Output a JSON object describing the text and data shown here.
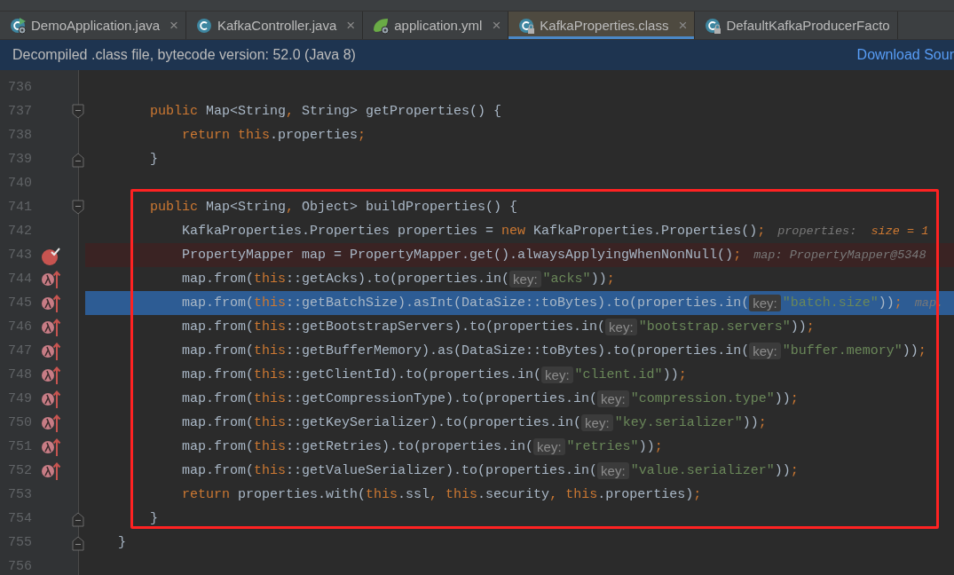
{
  "tabs": [
    {
      "label": "DemoApplication.java",
      "selected": false,
      "close": "×"
    },
    {
      "label": "KafkaController.java",
      "selected": false,
      "close": "×"
    },
    {
      "label": "application.yml",
      "selected": false,
      "close": "×"
    },
    {
      "label": "KafkaProperties.class",
      "selected": true,
      "close": "×"
    },
    {
      "label": "DefaultKafkaProducerFacto",
      "selected": false
    }
  ],
  "banner": {
    "message": "Decompiled .class file, bytecode version: 52.0 (Java 8)",
    "link": "Download Sour"
  },
  "editor": {
    "lines": [
      {
        "number": "736",
        "breakpoint": false,
        "lambda": false,
        "fold_start": false,
        "fold_end": false,
        "selected": false
      },
      {
        "number": "737",
        "breakpoint": false,
        "lambda": false,
        "fold_start": true,
        "fold_end": false,
        "selected": false,
        "segments": [
          {
            "kind": "code",
            "tokens": [
              {
                "text": "    public ",
                "kind": "keyword"
              },
              {
                "text": "Map<String",
                "kind": "plain"
              },
              {
                "text": ", ",
                "kind": "keyword"
              },
              {
                "text": "String> getProperties() {",
                "kind": "plain"
              }
            ]
          }
        ]
      },
      {
        "number": "738",
        "breakpoint": false,
        "lambda": false,
        "fold_start": false,
        "fold_end": false,
        "selected": false,
        "segments": [
          {
            "kind": "code",
            "tokens": [
              {
                "text": "        return this",
                "kind": "keyword"
              },
              {
                "text": ".properties",
                "kind": "plain"
              },
              {
                "text": ";",
                "kind": "keyword"
              }
            ]
          }
        ]
      },
      {
        "number": "739",
        "breakpoint": false,
        "lambda": false,
        "fold_start": false,
        "fold_end": true,
        "selected": false,
        "segments": [
          {
            "kind": "code",
            "tokens": [
              {
                "text": "    }",
                "kind": "plain"
              }
            ]
          }
        ]
      },
      {
        "number": "740",
        "breakpoint": false,
        "lambda": false,
        "fold_start": false,
        "fold_end": false,
        "selected": false
      },
      {
        "number": "741",
        "breakpoint": false,
        "lambda": false,
        "fold_start": true,
        "fold_end": false,
        "selected": false,
        "segments": [
          {
            "kind": "code",
            "tokens": [
              {
                "text": "    public ",
                "kind": "keyword"
              },
              {
                "text": "Map<String",
                "kind": "plain"
              },
              {
                "text": ", ",
                "kind": "keyword"
              },
              {
                "text": "Object> buildProperties() {",
                "kind": "plain"
              }
            ]
          }
        ]
      },
      {
        "number": "742",
        "breakpoint": false,
        "lambda": false,
        "fold_start": false,
        "fold_end": false,
        "selected": false,
        "segments": [
          {
            "kind": "code",
            "tokens": [
              {
                "text": "        KafkaProperties.Properties properties = ",
                "kind": "plain"
              },
              {
                "text": "new ",
                "kind": "keyword"
              },
              {
                "text": "KafkaProperties.Properties()",
                "kind": "plain"
              },
              {
                "text": ";",
                "kind": "keyword"
              }
            ]
          },
          {
            "kind": "debug",
            "parts": [
              {
                "text": "properties:",
                "kind": "name"
              },
              {
                "text": "size = 1",
                "kind": "value"
              }
            ]
          }
        ]
      },
      {
        "number": "743",
        "breakpoint": true,
        "lambda": false,
        "fold_start": false,
        "fold_end": false,
        "selected": false,
        "segments": [
          {
            "kind": "code",
            "tokens": [
              {
                "text": "        PropertyMapper map = PropertyMapper.get().alwaysApplyingWhenNonNull()",
                "kind": "plain"
              },
              {
                "text": ";",
                "kind": "keyword"
              }
            ]
          },
          {
            "kind": "debug",
            "parts": [
              {
                "text": "map: PropertyMapper@5348",
                "kind": "name"
              }
            ]
          }
        ]
      },
      {
        "number": "744",
        "breakpoint": false,
        "lambda": true,
        "fold_start": false,
        "fold_end": false,
        "selected": false,
        "segments": [
          {
            "kind": "code",
            "tokens": [
              {
                "text": "        map.from(",
                "kind": "plain"
              },
              {
                "text": "this",
                "kind": "keyword"
              },
              {
                "text": "::getAcks).to(properties.in(",
                "kind": "plain"
              }
            ]
          },
          {
            "kind": "hint",
            "text": "key:"
          },
          {
            "kind": "code",
            "tokens": [
              {
                "text": "\"acks\"",
                "kind": "string"
              },
              {
                "text": "))",
                "kind": "plain"
              },
              {
                "text": ";",
                "kind": "keyword"
              }
            ]
          }
        ]
      },
      {
        "number": "745",
        "breakpoint": false,
        "lambda": true,
        "fold_start": false,
        "fold_end": false,
        "selected": true,
        "segments": [
          {
            "kind": "code",
            "tokens": [
              {
                "text": "        map.from(",
                "kind": "plain"
              },
              {
                "text": "this",
                "kind": "keyword"
              },
              {
                "text": "::getBatchSize).asInt(DataSize::toBytes).to(properties.in(",
                "kind": "plain"
              }
            ]
          },
          {
            "kind": "hint",
            "text": "key:"
          },
          {
            "kind": "code",
            "tokens": [
              {
                "text": "\"batch.size\"",
                "kind": "string"
              },
              {
                "text": "))",
                "kind": "plain"
              },
              {
                "text": ";",
                "kind": "keyword"
              }
            ]
          },
          {
            "kind": "debug",
            "parts": [
              {
                "text": "map.",
                "kind": "name"
              }
            ]
          }
        ]
      },
      {
        "number": "746",
        "breakpoint": false,
        "lambda": true,
        "fold_start": false,
        "fold_end": false,
        "selected": false,
        "segments": [
          {
            "kind": "code",
            "tokens": [
              {
                "text": "        map.from(",
                "kind": "plain"
              },
              {
                "text": "this",
                "kind": "keyword"
              },
              {
                "text": "::getBootstrapServers).to(properties.in(",
                "kind": "plain"
              }
            ]
          },
          {
            "kind": "hint",
            "text": "key:"
          },
          {
            "kind": "code",
            "tokens": [
              {
                "text": "\"bootstrap.servers\"",
                "kind": "string"
              },
              {
                "text": "))",
                "kind": "plain"
              },
              {
                "text": ";",
                "kind": "keyword"
              }
            ]
          }
        ]
      },
      {
        "number": "747",
        "breakpoint": false,
        "lambda": true,
        "fold_start": false,
        "fold_end": false,
        "selected": false,
        "segments": [
          {
            "kind": "code",
            "tokens": [
              {
                "text": "        map.from(",
                "kind": "plain"
              },
              {
                "text": "this",
                "kind": "keyword"
              },
              {
                "text": "::getBufferMemory).as(DataSize::toBytes).to(properties.in(",
                "kind": "plain"
              }
            ]
          },
          {
            "kind": "hint",
            "text": "key:"
          },
          {
            "kind": "code",
            "tokens": [
              {
                "text": "\"buffer.memory\"",
                "kind": "string"
              },
              {
                "text": "))",
                "kind": "plain"
              },
              {
                "text": ";",
                "kind": "keyword"
              }
            ]
          }
        ]
      },
      {
        "number": "748",
        "breakpoint": false,
        "lambda": true,
        "fold_start": false,
        "fold_end": false,
        "selected": false,
        "segments": [
          {
            "kind": "code",
            "tokens": [
              {
                "text": "        map.from(",
                "kind": "plain"
              },
              {
                "text": "this",
                "kind": "keyword"
              },
              {
                "text": "::getClientId).to(properties.in(",
                "kind": "plain"
              }
            ]
          },
          {
            "kind": "hint",
            "text": "key:"
          },
          {
            "kind": "code",
            "tokens": [
              {
                "text": "\"client.id\"",
                "kind": "string"
              },
              {
                "text": "))",
                "kind": "plain"
              },
              {
                "text": ";",
                "kind": "keyword"
              }
            ]
          }
        ]
      },
      {
        "number": "749",
        "breakpoint": false,
        "lambda": true,
        "fold_start": false,
        "fold_end": false,
        "selected": false,
        "segments": [
          {
            "kind": "code",
            "tokens": [
              {
                "text": "        map.from(",
                "kind": "plain"
              },
              {
                "text": "this",
                "kind": "keyword"
              },
              {
                "text": "::getCompressionType).to(properties.in(",
                "kind": "plain"
              }
            ]
          },
          {
            "kind": "hint",
            "text": "key:"
          },
          {
            "kind": "code",
            "tokens": [
              {
                "text": "\"compression.type\"",
                "kind": "string"
              },
              {
                "text": "))",
                "kind": "plain"
              },
              {
                "text": ";",
                "kind": "keyword"
              }
            ]
          }
        ]
      },
      {
        "number": "750",
        "breakpoint": false,
        "lambda": true,
        "fold_start": false,
        "fold_end": false,
        "selected": false,
        "segments": [
          {
            "kind": "code",
            "tokens": [
              {
                "text": "        map.from(",
                "kind": "plain"
              },
              {
                "text": "this",
                "kind": "keyword"
              },
              {
                "text": "::getKeySerializer).to(properties.in(",
                "kind": "plain"
              }
            ]
          },
          {
            "kind": "hint",
            "text": "key:"
          },
          {
            "kind": "code",
            "tokens": [
              {
                "text": "\"key.serializer\"",
                "kind": "string"
              },
              {
                "text": "))",
                "kind": "plain"
              },
              {
                "text": ";",
                "kind": "keyword"
              }
            ]
          }
        ]
      },
      {
        "number": "751",
        "breakpoint": false,
        "lambda": true,
        "fold_start": false,
        "fold_end": false,
        "selected": false,
        "segments": [
          {
            "kind": "code",
            "tokens": [
              {
                "text": "        map.from(",
                "kind": "plain"
              },
              {
                "text": "this",
                "kind": "keyword"
              },
              {
                "text": "::getRetries).to(properties.in(",
                "kind": "plain"
              }
            ]
          },
          {
            "kind": "hint",
            "text": "key:"
          },
          {
            "kind": "code",
            "tokens": [
              {
                "text": "\"retries\"",
                "kind": "string"
              },
              {
                "text": "))",
                "kind": "plain"
              },
              {
                "text": ";",
                "kind": "keyword"
              }
            ]
          }
        ]
      },
      {
        "number": "752",
        "breakpoint": false,
        "lambda": true,
        "fold_start": false,
        "fold_end": false,
        "selected": false,
        "segments": [
          {
            "kind": "code",
            "tokens": [
              {
                "text": "        map.from(",
                "kind": "plain"
              },
              {
                "text": "this",
                "kind": "keyword"
              },
              {
                "text": "::getValueSerializer).to(properties.in(",
                "kind": "plain"
              }
            ]
          },
          {
            "kind": "hint",
            "text": "key:"
          },
          {
            "kind": "code",
            "tokens": [
              {
                "text": "\"value.serializer\"",
                "kind": "string"
              },
              {
                "text": "))",
                "kind": "plain"
              },
              {
                "text": ";",
                "kind": "keyword"
              }
            ]
          }
        ]
      },
      {
        "number": "753",
        "breakpoint": false,
        "lambda": false,
        "fold_start": false,
        "fold_end": false,
        "selected": false,
        "segments": [
          {
            "kind": "code",
            "tokens": [
              {
                "text": "        return ",
                "kind": "keyword"
              },
              {
                "text": "properties.with(",
                "kind": "plain"
              },
              {
                "text": "this",
                "kind": "keyword"
              },
              {
                "text": ".ssl",
                "kind": "plain"
              },
              {
                "text": ", this",
                "kind": "keyword"
              },
              {
                "text": ".security",
                "kind": "plain"
              },
              {
                "text": ", this",
                "kind": "keyword"
              },
              {
                "text": ".properties)",
                "kind": "plain"
              },
              {
                "text": ";",
                "kind": "keyword"
              }
            ]
          }
        ]
      },
      {
        "number": "754",
        "breakpoint": false,
        "lambda": false,
        "fold_start": false,
        "fold_end": true,
        "selected": false,
        "segments": [
          {
            "kind": "code",
            "tokens": [
              {
                "text": "    }",
                "kind": "plain"
              }
            ]
          }
        ]
      },
      {
        "number": "755",
        "breakpoint": false,
        "lambda": false,
        "fold_start": false,
        "fold_end": true,
        "selected": false,
        "segments": [
          {
            "kind": "code",
            "tokens": [
              {
                "text": "}",
                "kind": "plain"
              }
            ]
          }
        ]
      },
      {
        "number": "756",
        "breakpoint": false,
        "lambda": false,
        "fold_start": false,
        "fold_end": false,
        "selected": false
      }
    ]
  }
}
